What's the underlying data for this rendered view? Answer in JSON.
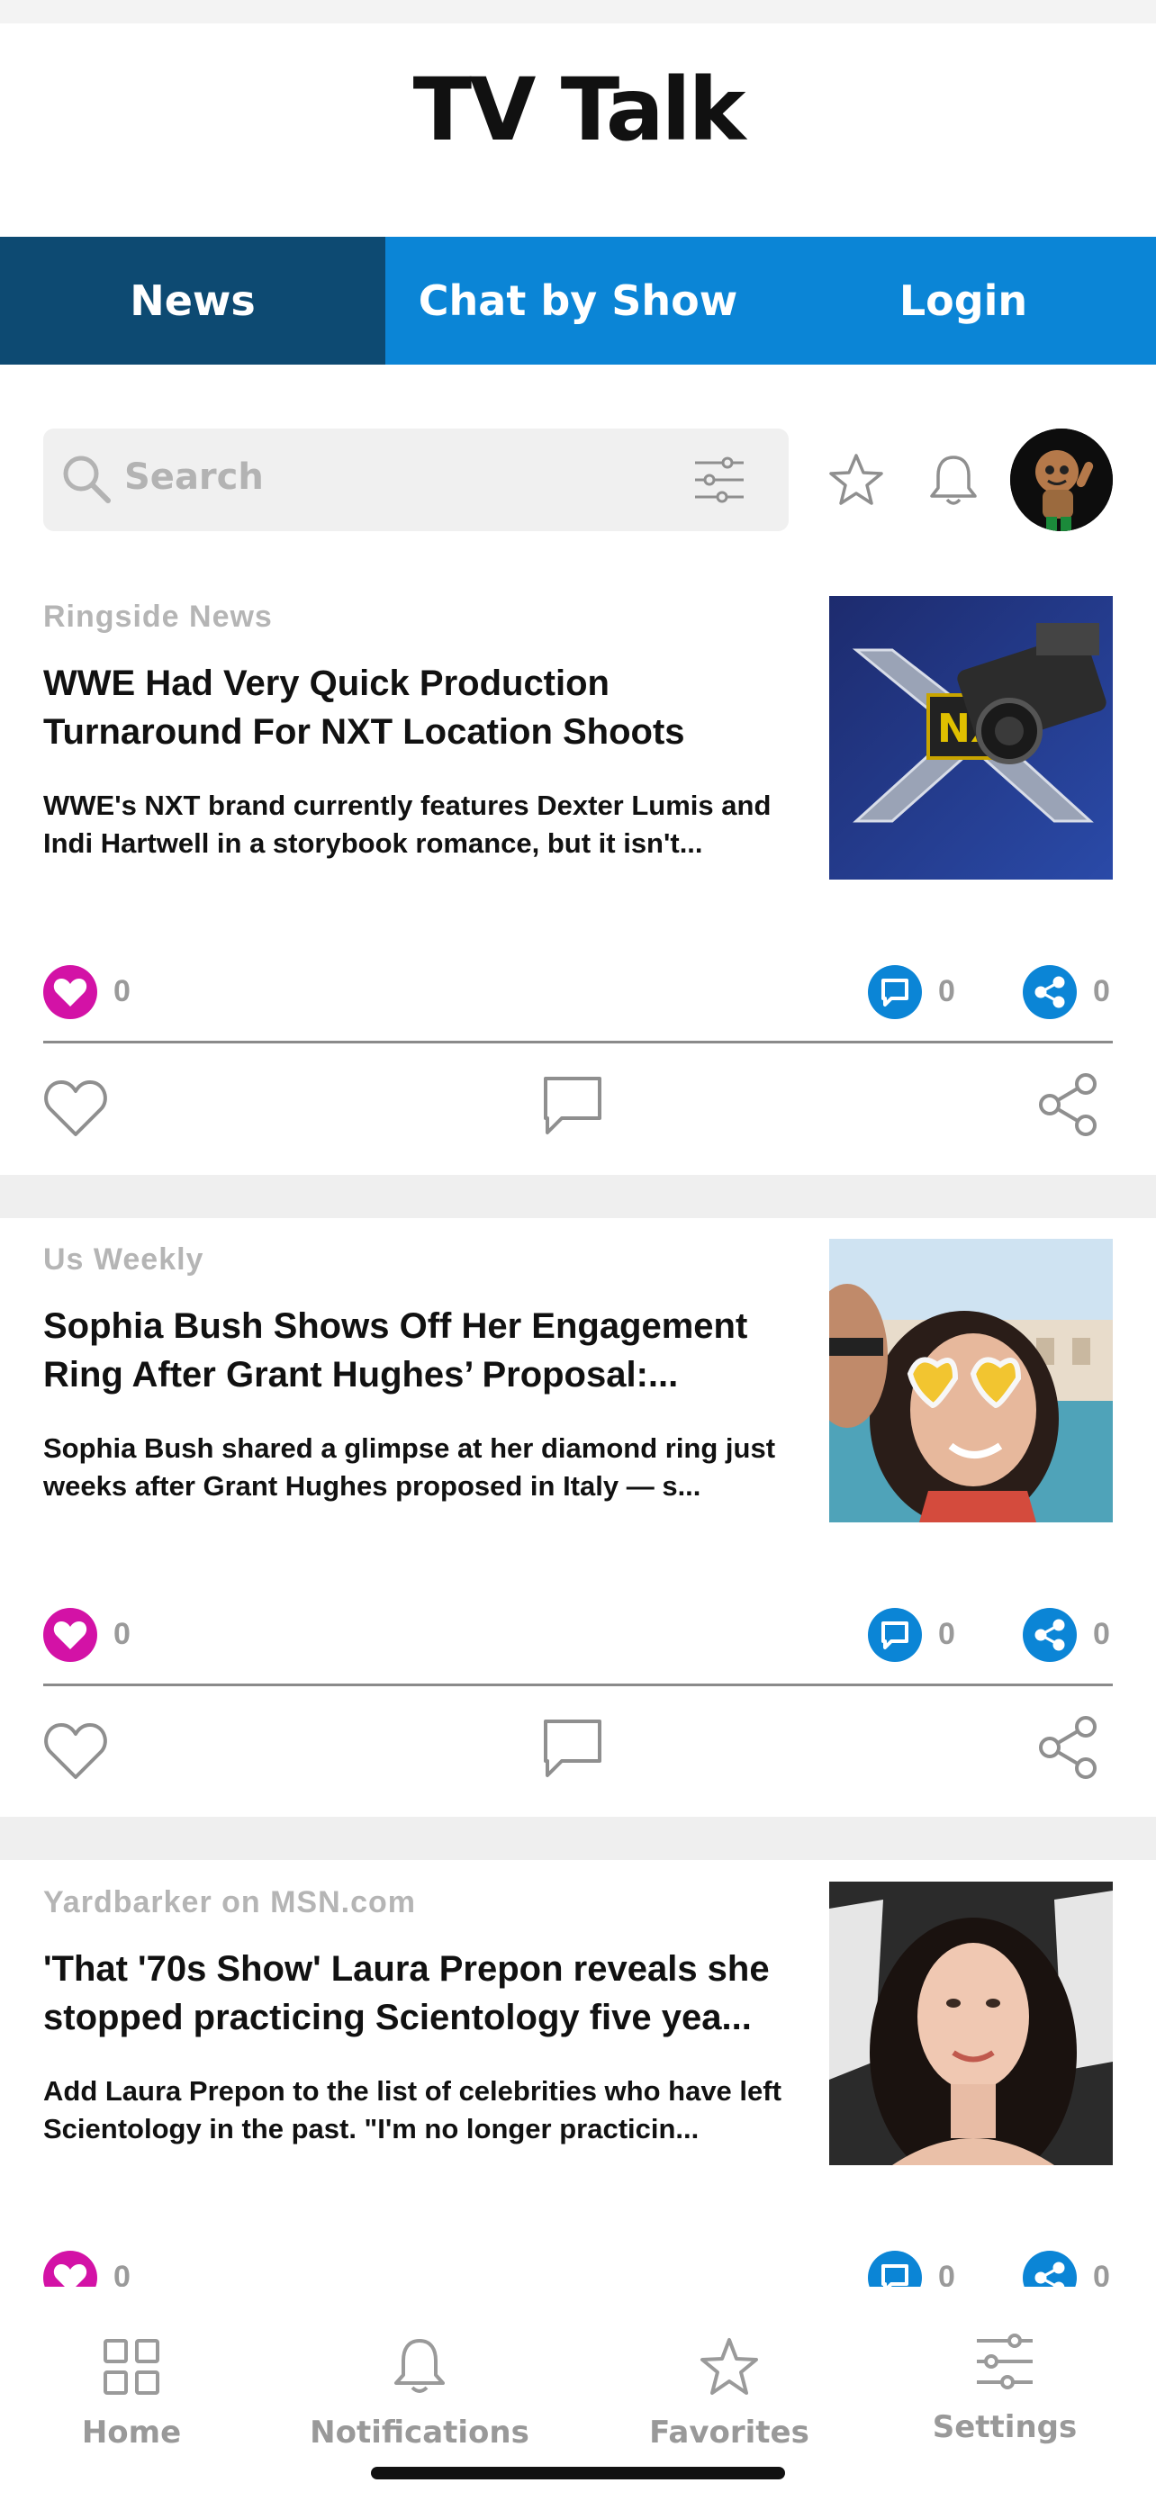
{
  "app": {
    "title": "TV Talk"
  },
  "tabs": [
    {
      "label": "News",
      "active": true
    },
    {
      "label": "Chat by Show",
      "active": false
    },
    {
      "label": "Login",
      "active": false
    }
  ],
  "search": {
    "placeholder": "Search"
  },
  "header_icons": [
    "star-icon",
    "bell-icon",
    "avatar"
  ],
  "articles": [
    {
      "source": "Ringside News",
      "headline": "WWE Had Very Quick Production Turnaround For NXT Location Shoots",
      "summary": "WWE's NXT brand currently features Dexter Lumis and Indi Hartwell in a storybook romance, but it isn't...",
      "likes": "0",
      "comments": "0",
      "shares": "0"
    },
    {
      "source": "Us Weekly",
      "headline": "Sophia Bush Shows Off Her Engagement Ring After Grant Hughes’ Proposal:...",
      "summary": "Sophia Bush shared a glimpse at her diamond ring just weeks after Grant Hughes proposed in Italy — s...",
      "likes": "0",
      "comments": "0",
      "shares": "0"
    },
    {
      "source": "Yardbarker on MSN.com",
      "headline": "'That '70s Show' Laura Prepon reveals she stopped practicing Scientology five yea...",
      "summary": "Add Laura Prepon to the list of celebrities who have left Scientology in the past. \"I'm no longer practicin...",
      "likes": "0",
      "comments": "0",
      "shares": "0"
    }
  ],
  "bottom_nav": [
    {
      "label": "Home",
      "icon": "grid-icon"
    },
    {
      "label": "Notifications",
      "icon": "bell-icon"
    },
    {
      "label": "Favorites",
      "icon": "star-icon"
    },
    {
      "label": "Settings",
      "icon": "sliders-icon"
    }
  ],
  "colors": {
    "tab_active": "#0d4a72",
    "tab": "#0b85d6",
    "like": "#d312a6",
    "accent": "#0b85d6"
  }
}
